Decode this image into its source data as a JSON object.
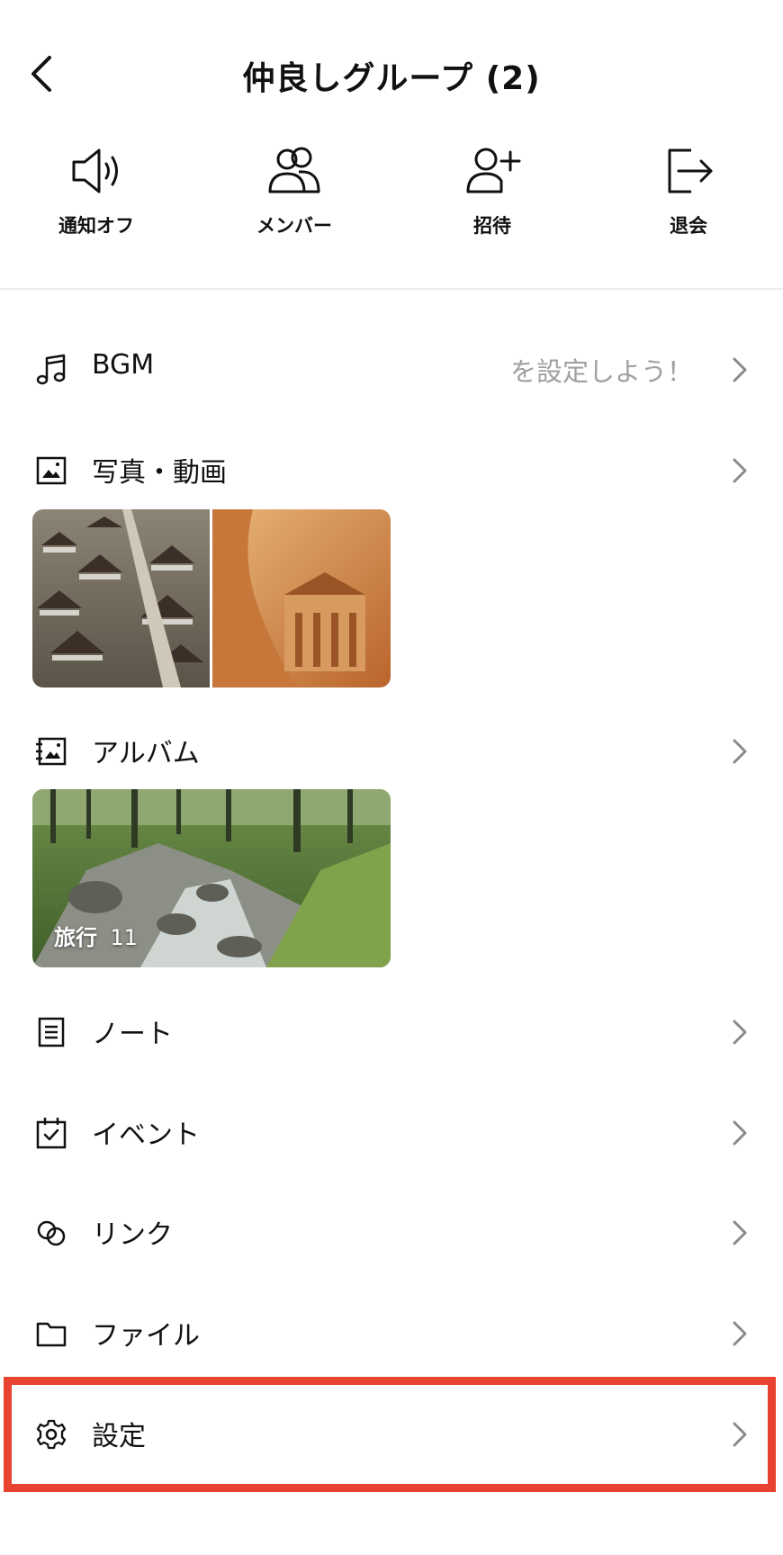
{
  "header": {
    "title": "仲良しグループ (2)"
  },
  "actions": [
    {
      "label": "通知オフ",
      "icon": "speaker-icon"
    },
    {
      "label": "メンバー",
      "icon": "members-icon"
    },
    {
      "label": "招待",
      "icon": "add-user-icon"
    },
    {
      "label": "退会",
      "icon": "exit-icon"
    }
  ],
  "menu": {
    "bgm": {
      "label": "BGM",
      "value": "を設定しよう！"
    },
    "photos": {
      "label": "写真・動画"
    },
    "album": {
      "label": "アルバム",
      "album_title": "旅行",
      "album_count": "11"
    },
    "note": {
      "label": "ノート"
    },
    "event": {
      "label": "イベント"
    },
    "link": {
      "label": "リンク"
    },
    "file": {
      "label": "ファイル"
    },
    "settings": {
      "label": "設定"
    }
  },
  "colors": {
    "highlight": "#e84230",
    "chevron": "#8a8a8a",
    "muted": "#a0a0a0"
  }
}
